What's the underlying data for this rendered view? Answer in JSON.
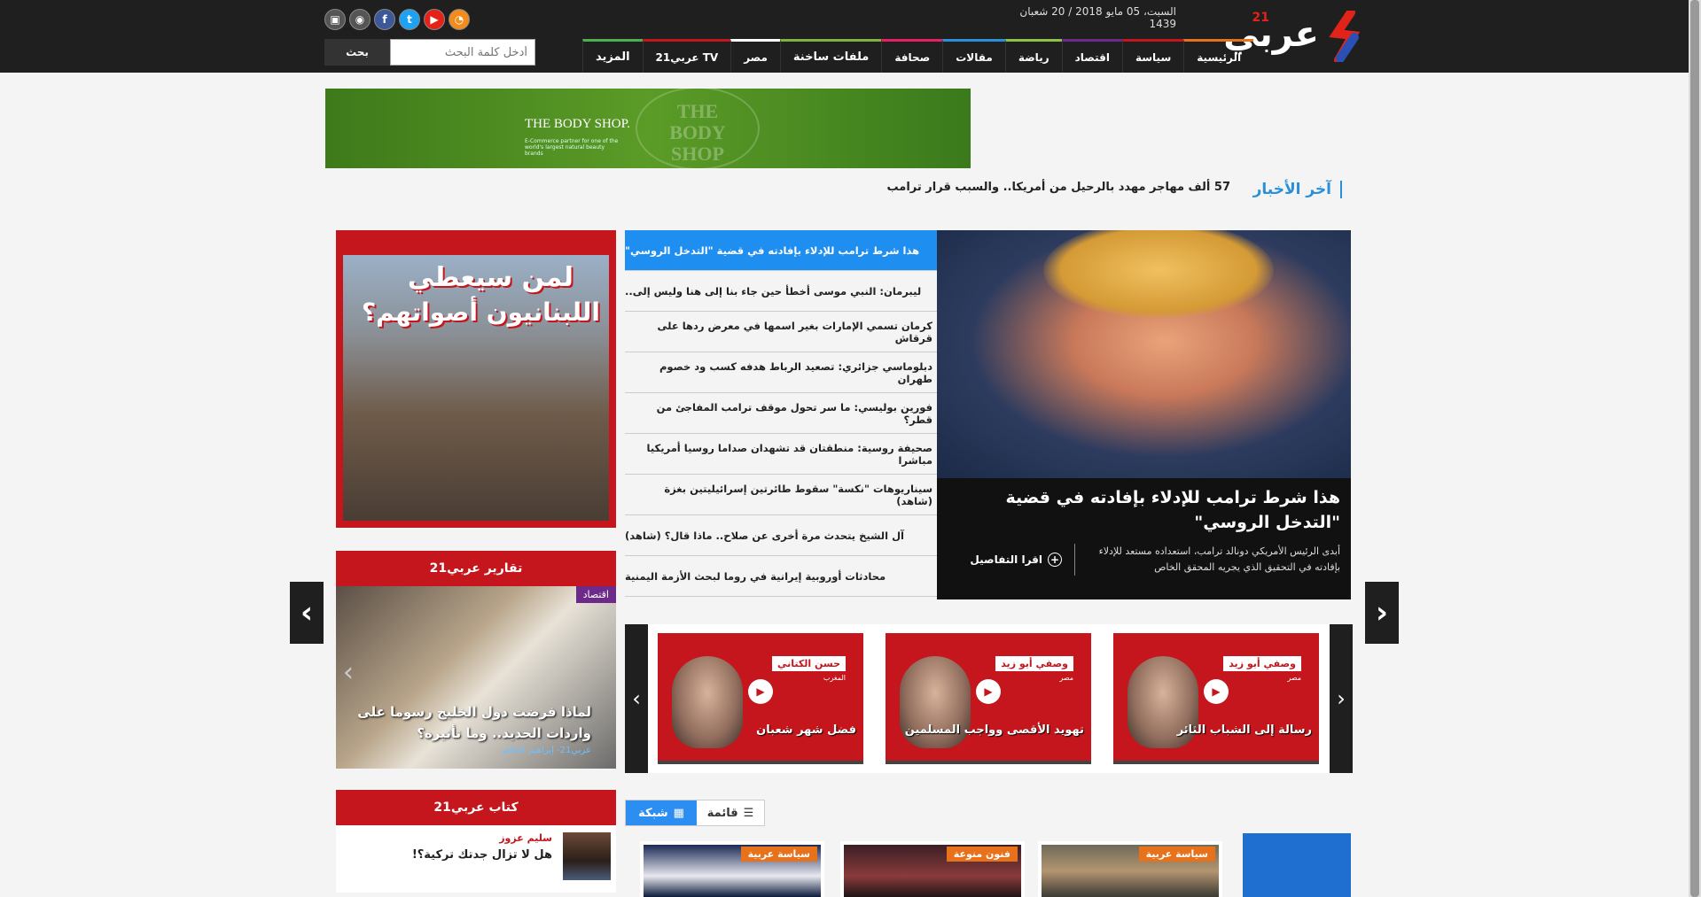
{
  "header": {
    "brand": "عربي",
    "brand_num": "21",
    "date": "السبت، 05 مايو 2018 / 20 شعبان 1439",
    "search_placeholder": "أدخل كلمة البحث",
    "search_button": "بحث",
    "social": [
      "tv-icon",
      "camera-icon",
      "facebook-icon",
      "twitter-icon",
      "youtube-icon",
      "rss-icon"
    ]
  },
  "nav": {
    "items": [
      {
        "label": "الرئيسية",
        "color": "#e8721c"
      },
      {
        "label": "سياسة",
        "color": "#c4161c"
      },
      {
        "label": "اقتصاد",
        "color": "#6d2a8a"
      },
      {
        "label": "رياضة",
        "color": "#8bc34a"
      },
      {
        "label": "مقالات",
        "color": "#2a8fd8"
      },
      {
        "label": "صحافة",
        "color": "#e91e63"
      },
      {
        "label": "ملفات ساخنة",
        "color": "#7cb342"
      },
      {
        "label": "مصر",
        "color": "#ffffff"
      },
      {
        "label": "عربي21 TV",
        "color": "#c4161c"
      },
      {
        "label": "المزيد",
        "color": "#4caf50"
      }
    ]
  },
  "ad": {
    "brand": "THE BODY SHOP.",
    "tagline": "E-Commerce partner for one of the world's largest natural beauty brands",
    "logo_line1": "THE",
    "logo_line2": "BODY",
    "logo_line3": "SHOP"
  },
  "latest": {
    "label": "آخر الأخبار",
    "text": "57 ألف مهاجر مهدد بالرحيل من أمريكا.. والسبب قرار ترامب"
  },
  "hero": {
    "title": "هذا شرط ترامب للإدلاء بإفادته في قضية \"التدخل الروسي\"",
    "summary": "أبدى الرئيس الأمريكي دونالد ترامب، استعداده مستعد للإدلاء بإفادته في التحقيق الذي يجريه المحقق الخاص",
    "more": "اقرا التفاصيل"
  },
  "headlines": [
    "هذا شرط ترامب للإدلاء بإفادته في قضية \"التدخل الروسي\"",
    "ليبرمان: النبي موسى أخطأ حين جاء بنا إلى هنا وليس إلى..",
    "كرمان تسمي الإمارات بغير اسمها في معرض ردها على قرقاش",
    "دبلوماسي جزائري: تصعيد الرباط هدفه كسب ود خصوم طهران",
    "فورين بوليسي: ما سر تحول موقف ترامب المفاجئ من قطر؟",
    "صحيفة روسية: منطقتان قد تشهدان صداما روسيا أمريكيا مباشرا",
    "سيناريوهات \"نكسة\" سقوط طائرتين إسرائيليتين بغزة (شاهد)",
    "آل الشيخ يتحدث مرة أخرى عن صلاح.. ماذا قال؟ (شاهد)",
    "محادثات أوروبية إيرانية في روما لبحث الأزمة اليمنية"
  ],
  "left_ad": {
    "line1": "لمن سيعطي",
    "line2": "اللبنانيون أصواتهم؟"
  },
  "reports": {
    "heading": "تقارير عربي21",
    "badge": "اقتصاد",
    "title": "لماذا فرضت دول الخليج رسوما على واردات الحديد.. وما تأثيره؟",
    "byline": "عربي21- إبراهيم الطاهر"
  },
  "videos": [
    {
      "name": "وصفي أبو زيد",
      "country": "مصر",
      "caption": "رسالة إلى الشباب الثائر"
    },
    {
      "name": "وصفي أبو زيد",
      "country": "مصر",
      "caption": "تهويد الأقصى وواجب المسلمين"
    },
    {
      "name": "حسن الكتاني",
      "country": "المغرب",
      "caption": "فضل شهر شعبان"
    }
  ],
  "writers": {
    "heading": "كتاب عربي21",
    "name": "سليم عزوز",
    "title": "هل لا تزال جدتك تركية؟!"
  },
  "view_toggle": {
    "grid": "شبكة",
    "list": "قائمة"
  },
  "cards": [
    "سياسة عربية",
    "فنون منوعة",
    "سياسة عربية"
  ]
}
